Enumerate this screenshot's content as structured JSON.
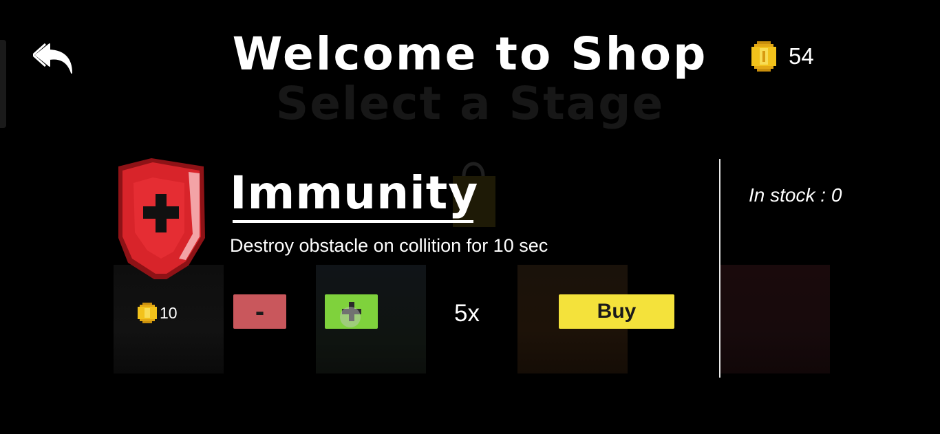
{
  "header": {
    "title": "Welcome to Shop",
    "background_title": "Select a Stage",
    "coins": "54"
  },
  "item": {
    "name": "Immunity",
    "description": "Destroy obstacle on collition for 10 sec",
    "price": "10",
    "minus_label": "-",
    "plus_label": "+",
    "quantity": "5x",
    "buy_label": "Buy",
    "stock_text": "In stock : 0"
  },
  "icons": {
    "back": "back-arrow-icon",
    "coin": "coin-icon",
    "shield": "shield-icon",
    "bag": "shopping-bag-icon"
  },
  "colors": {
    "minus_button": "#c9575c",
    "plus_button": "#7fd23c",
    "buy_button": "#f4e23b",
    "coin": "#f2c21b",
    "shield": "#d8242a"
  }
}
